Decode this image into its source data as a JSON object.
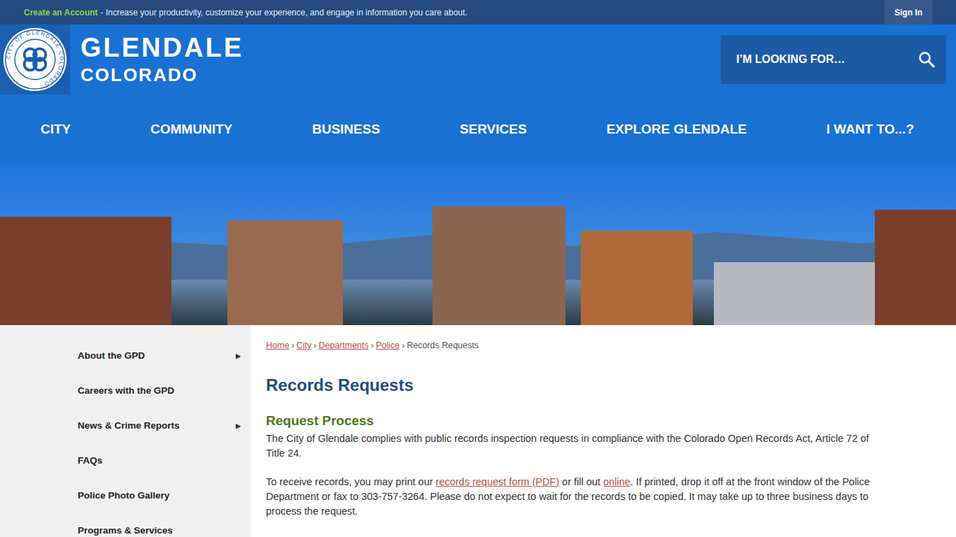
{
  "top_bar": {
    "cta": "Create an Account",
    "message": "- Increase your productivity, customize your experience, and engage in information you care about.",
    "sign_in": "Sign In"
  },
  "header": {
    "seal_text": "CITY OF GLENDALE COLORADO",
    "title": "GLENDALE",
    "subtitle": "COLORADO",
    "search": {
      "placeholder": "I’M LOOKING FOR…"
    }
  },
  "nav": [
    "CITY",
    "COMMUNITY",
    "BUSINESS",
    "SERVICES",
    "EXPLORE GLENDALE",
    "I WANT TO...?"
  ],
  "sidebar": {
    "submenu_arrow": "▶",
    "items": [
      {
        "label": "About the GPD",
        "has_submenu": true
      },
      {
        "label": "Careers with the GPD",
        "has_submenu": false
      },
      {
        "label": "News & Crime Reports",
        "has_submenu": true
      },
      {
        "label": "FAQs",
        "has_submenu": false
      },
      {
        "label": "Police Photo Gallery",
        "has_submenu": false
      },
      {
        "label": "Programs & Services",
        "has_submenu": false
      }
    ]
  },
  "breadcrumb": {
    "separator": "›",
    "items": [
      {
        "label": "Home",
        "link": true
      },
      {
        "label": "City",
        "link": true
      },
      {
        "label": "Departments",
        "link": true
      },
      {
        "label": "Police",
        "link": true
      },
      {
        "label": "Records Requests",
        "link": false
      }
    ]
  },
  "page": {
    "title": "Records Requests",
    "section_title": "Request Process",
    "paragraphs": [
      [
        {
          "text": "The City of Glendale complies with public records inspection requests in compliance with the Colorado Open Records Act, Article 72 of Title 24.",
          "link": false
        }
      ],
      [
        {
          "text": "To receive records, you may print our ",
          "link": false
        },
        {
          "text": "records request form (PDF)",
          "link": true
        },
        {
          "text": " or fill out ",
          "link": false
        },
        {
          "text": "online",
          "link": true
        },
        {
          "text": ". If printed, drop it off at the front window of the Police Department or fax to 303-757-3264. Please do not expect to wait for the records to be copied. It may take up to three business days to process the request.",
          "link": false
        }
      ]
    ]
  }
}
